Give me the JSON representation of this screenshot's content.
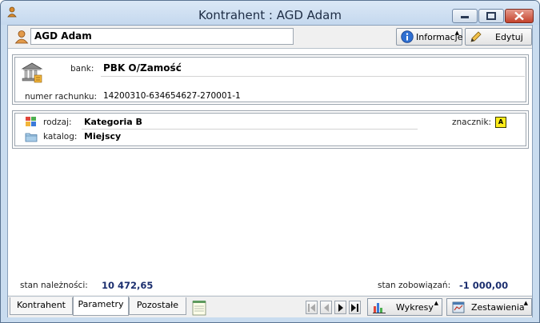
{
  "window": {
    "title": "Kontrahent : AGD Adam"
  },
  "header": {
    "name": "AGD Adam",
    "info_button": "Informacje",
    "edit_button": "Edytuj"
  },
  "bank_section": {
    "bank_label": "bank:",
    "bank_value": "PBK O/Zamość",
    "account_label": "numer rachunku:",
    "account_value": "14200310-634654627-270001-1"
  },
  "class_section": {
    "type_label": "rodzaj:",
    "type_value": "Kategoria B",
    "catalog_label": "katalog:",
    "catalog_value": "Miejscy",
    "marker_label": "znacznik:",
    "marker_value": "A"
  },
  "totals": {
    "receivables_label": "stan należności:",
    "receivables_value": "10 472,65",
    "liabilities_label": "stan zobowiązań:",
    "liabilities_value": "-1 000,00"
  },
  "footer": {
    "tabs": [
      {
        "label": "Kontrahent"
      },
      {
        "label": "Parametry"
      },
      {
        "label": "Pozostałe"
      }
    ],
    "charts_button": "Wykresy",
    "reports_button": "Zestawienia"
  },
  "colors": {
    "totals_value": "#1c2f6f",
    "marker_bg": "#ffec1a"
  }
}
